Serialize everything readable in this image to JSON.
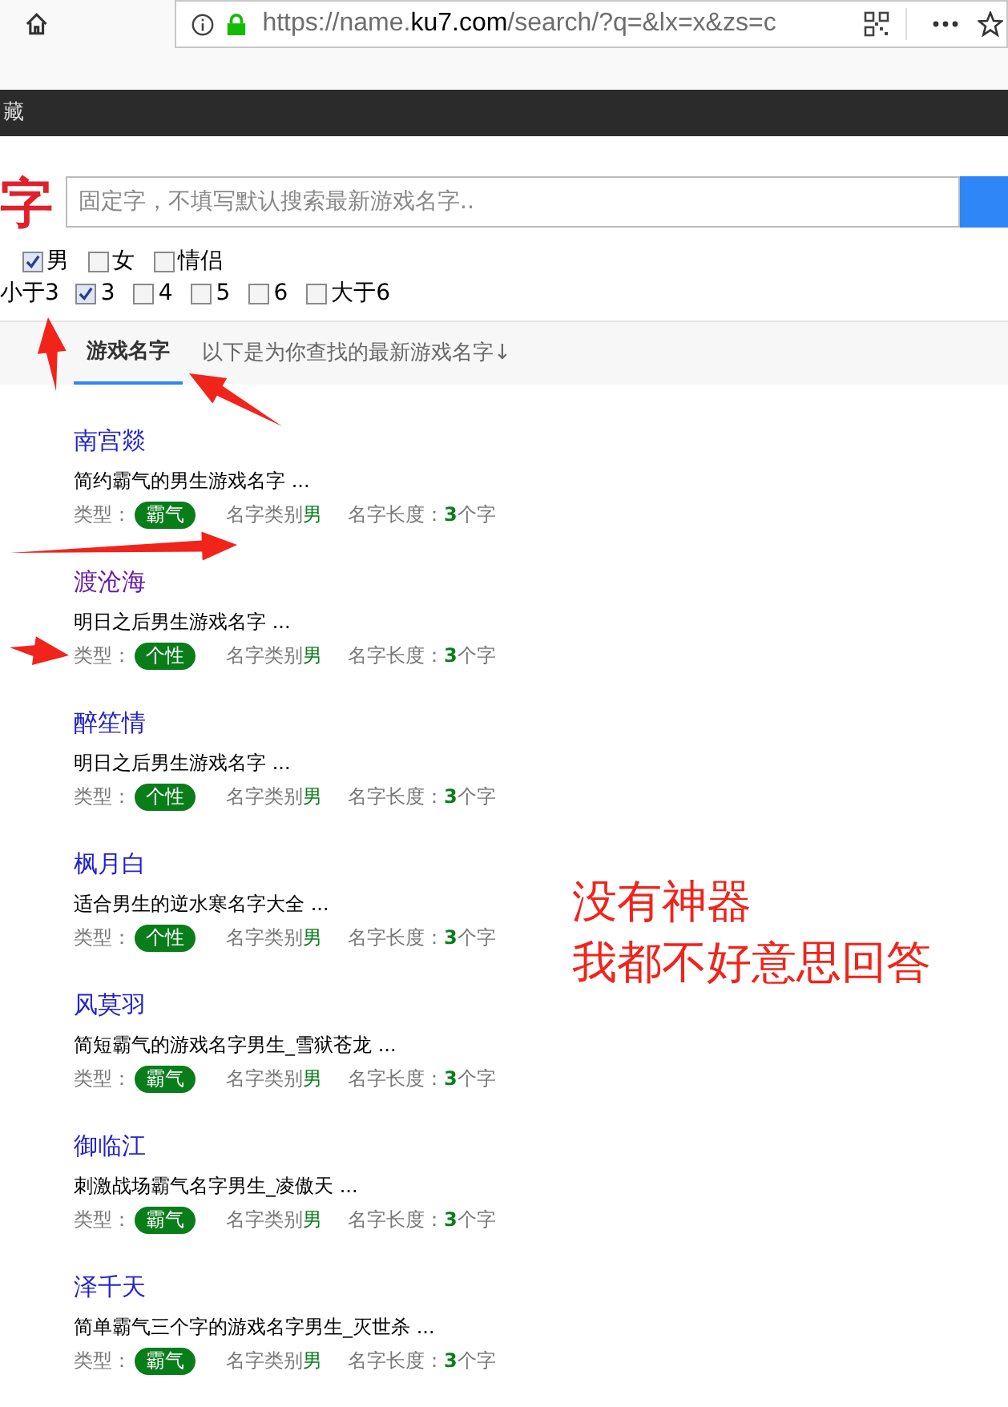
{
  "browser": {
    "url": {
      "prefix": "https://name.",
      "domain": "ku7.com",
      "path": "/search/?q=&lx=x&zs=c"
    }
  },
  "nav_bar": {
    "text": "藏"
  },
  "search": {
    "title": "字",
    "placeholder": "固定字，不填写默认搜索最新游戏名字.."
  },
  "gender_options": [
    {
      "label": "男",
      "checked": true
    },
    {
      "label": "女",
      "checked": false
    },
    {
      "label": "情侣",
      "checked": false
    }
  ],
  "length_options": {
    "lead": "小于3",
    "items": [
      {
        "label": "3",
        "checked": true
      },
      {
        "label": "4",
        "checked": false
      },
      {
        "label": "5",
        "checked": false
      },
      {
        "label": "6",
        "checked": false
      },
      {
        "label": "大于6",
        "checked": false
      }
    ]
  },
  "tabs": [
    {
      "label": "游戏名字",
      "selected": true
    }
  ],
  "tab_note": "以下是为你查找的最新游戏名字↓",
  "results": [
    {
      "name": "南宫燚",
      "visited": false,
      "desc": "简约霸气的男生游戏名字 ...",
      "type_label": "类型：",
      "type": "霸气",
      "category_label": "名字类别",
      "category": "男",
      "length_label": "名字长度：",
      "length": "3",
      "length_unit": "个字"
    },
    {
      "name": "渡沧海",
      "visited": true,
      "desc": "明日之后男生游戏名字 ...",
      "type_label": "类型：",
      "type": "个性",
      "category_label": "名字类别",
      "category": "男",
      "length_label": "名字长度：",
      "length": "3",
      "length_unit": "个字"
    },
    {
      "name": "醉笙情",
      "visited": false,
      "desc": "明日之后男生游戏名字 ...",
      "type_label": "类型：",
      "type": "个性",
      "category_label": "名字类别",
      "category": "男",
      "length_label": "名字长度：",
      "length": "3",
      "length_unit": "个字"
    },
    {
      "name": "枫月白",
      "visited": false,
      "desc": "适合男生的逆水寒名字大全 ...",
      "type_label": "类型：",
      "type": "个性",
      "category_label": "名字类别",
      "category": "男",
      "length_label": "名字长度：",
      "length": "3",
      "length_unit": "个字"
    },
    {
      "name": "风莫羽",
      "visited": false,
      "desc": "简短霸气的游戏名字男生_雪狱苍龙 ...",
      "type_label": "类型：",
      "type": "霸气",
      "category_label": "名字类别",
      "category": "男",
      "length_label": "名字长度：",
      "length": "3",
      "length_unit": "个字"
    },
    {
      "name": "御临江",
      "visited": false,
      "desc": "刺激战场霸气名字男生_凌傲天 ...",
      "type_label": "类型：",
      "type": "霸气",
      "category_label": "名字类别",
      "category": "男",
      "length_label": "名字长度：",
      "length": "3",
      "length_unit": "个字"
    },
    {
      "name": "泽千天",
      "visited": false,
      "desc": "简单霸气三个字的游戏名字男生_灭世杀 ...",
      "type_label": "类型：",
      "type": "霸气",
      "category_label": "名字类别",
      "category": "男",
      "length_label": "名字长度：",
      "length": "3",
      "length_unit": "个字"
    }
  ],
  "annotation": {
    "lines": [
      "没有神器",
      "我都不好意思回答"
    ]
  }
}
